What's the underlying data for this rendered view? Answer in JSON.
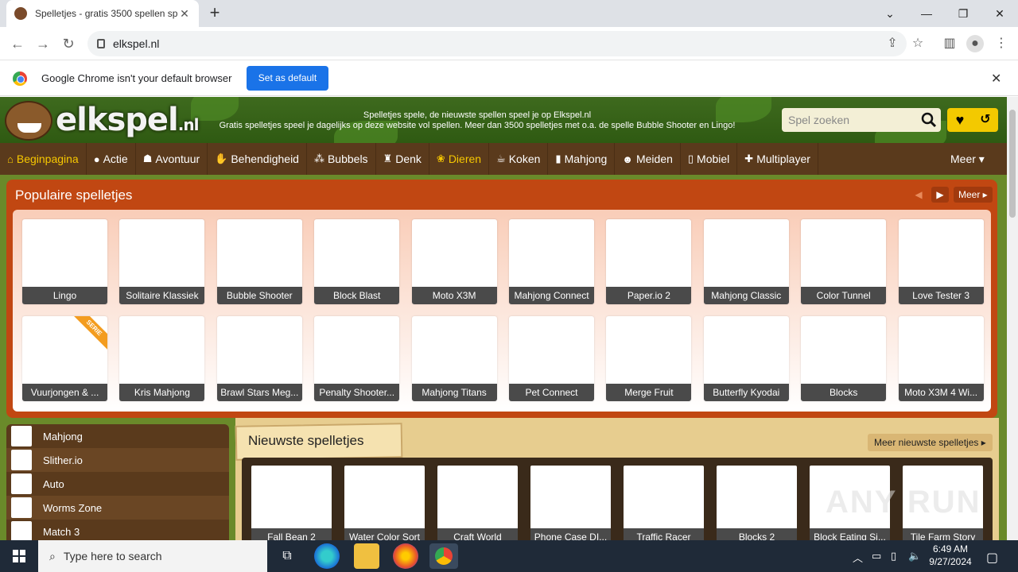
{
  "browser": {
    "tab_title": "Spelletjes - gratis 3500 spellen sp",
    "url": "elkspel.nl",
    "infobar_text": "Google Chrome isn't your default browser",
    "set_default_label": "Set as default"
  },
  "site": {
    "logo_text": "elkspel",
    "logo_suffix": ".nl",
    "tagline_1": "Spelletjes spele, de nieuwste spellen speel je op Elkspel.nl",
    "tagline_2": "Gratis spelletjes speel je dagelijks op deze website vol spellen. Meer dan 3500 spelletjes met o.a. de spelle Bubble Shooter en Lingo!",
    "search_placeholder": "Spel zoeken",
    "nav": [
      {
        "label": "Beginpagina",
        "icon": "home-icon"
      },
      {
        "label": "Actie",
        "icon": "bomb-icon"
      },
      {
        "label": "Avontuur",
        "icon": "explorer-icon"
      },
      {
        "label": "Behendigheid",
        "icon": "hand-icon"
      },
      {
        "label": "Bubbels",
        "icon": "bubbles-icon"
      },
      {
        "label": "Denk",
        "icon": "chess-icon"
      },
      {
        "label": "Dieren",
        "icon": "paw-icon"
      },
      {
        "label": "Koken",
        "icon": "pot-icon"
      },
      {
        "label": "Mahjong",
        "icon": "tile-icon"
      },
      {
        "label": "Meiden",
        "icon": "girl-icon"
      },
      {
        "label": "Mobiel",
        "icon": "mobile-icon"
      },
      {
        "label": "Multiplayer",
        "icon": "gamepad-icon"
      }
    ],
    "nav_more": "Meer"
  },
  "popular": {
    "title": "Populaire spelletjes",
    "more_label": "Meer",
    "games": [
      "Lingo",
      "Solitaire Klassiek",
      "Bubble Shooter",
      "Block Blast",
      "Moto X3M",
      "Mahjong Connect",
      "Paper.io 2",
      "Mahjong Classic",
      "Color Tunnel",
      "Love Tester 3",
      "Vuurjongen & ...",
      "Kris Mahjong",
      "Brawl Stars Meg...",
      "Penalty Shooter...",
      "Mahjong Titans",
      "Pet Connect",
      "Merge Fruit",
      "Butterfly Kyodai",
      "Blocks",
      "Moto X3M 4 Wi..."
    ],
    "ribbon": "SERIE"
  },
  "categories": [
    "Mahjong",
    "Slither.io",
    "Auto",
    "Worms Zone",
    "Match 3"
  ],
  "newest": {
    "title": "Nieuwste spelletjes",
    "more_label": "Meer nieuwste spelletjes",
    "games": [
      "Fall Bean 2",
      "Water Color Sort",
      "Craft World",
      "Phone Case DI...",
      "Traffic Racer",
      "Blocks 2",
      "Block Eating Si...",
      "Tile Farm Story"
    ]
  },
  "watermark": "ANY RUN",
  "taskbar": {
    "search_placeholder": "Type here to search",
    "time": "6:49 AM",
    "date": "9/27/2024"
  }
}
